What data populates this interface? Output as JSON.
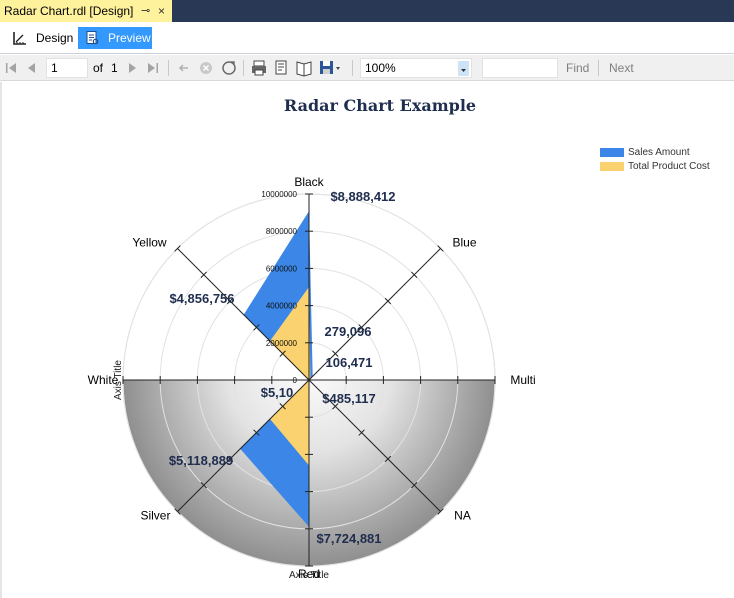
{
  "tab": {
    "title": "Radar Chart.rdl [Design]",
    "pin": "⊸",
    "close": "×"
  },
  "modes": {
    "design_label": "Design",
    "preview_label": "Preview"
  },
  "toolbar": {
    "first_icon": "first-page-icon",
    "prev_icon": "previous-page-icon",
    "page_value": "1",
    "of_label": "of",
    "total_pages": "1",
    "next_icon": "next-page-icon",
    "last_icon": "last-page-icon",
    "zoom_value": "100%",
    "find_label": "Find",
    "next_label": "Next"
  },
  "report": {
    "title": "Radar Chart Example"
  },
  "colors": {
    "accent_tab": "#fff29d",
    "preview_bg": "#3399ff",
    "sales": "#3b86e6",
    "cost": "#fad26f",
    "title": "#1f2d4e"
  },
  "chart_data": {
    "type": "radar",
    "title": "Radar Chart Example",
    "categories": [
      "Black",
      "Blue",
      "Multi",
      "NA",
      "Red",
      "Silver",
      "White",
      "Yellow"
    ],
    "series": [
      {
        "name": "Sales Amount",
        "color": "#3b86e6",
        "values": [
          8888412,
          279096,
          0,
          0,
          7724881,
          5118889,
          0,
          4856756
        ]
      },
      {
        "name": "Total Product Cost",
        "color": "#fad26f",
        "values": [
          4900000,
          106471,
          0,
          0,
          4500000,
          2900000,
          0,
          2900000
        ]
      }
    ],
    "data_labels": [
      {
        "text": "$8,888,412",
        "cat": "Black"
      },
      {
        "text": "279,096",
        "cat": "Blue"
      },
      {
        "text": "106,471",
        "cat": "Blue"
      },
      {
        "text": "$485,117",
        "cat": "NA"
      },
      {
        "text": "$7,724,881",
        "cat": "Red"
      },
      {
        "text": "$5,118,889",
        "cat": "Silver"
      },
      {
        "text": "$5,10",
        "cat": "White"
      },
      {
        "text": "$4,856,756",
        "cat": "Yellow"
      }
    ],
    "radial_ticks": [
      "0",
      "2000000",
      "4000000",
      "6000000",
      "8000000",
      "10000000"
    ],
    "rmax": 10000000,
    "axis_title_vertical": "Axis Title",
    "axis_title_bottom": "Axis Title",
    "legend": [
      "Sales Amount",
      "Total Product Cost"
    ],
    "legend_position": "top-right"
  }
}
